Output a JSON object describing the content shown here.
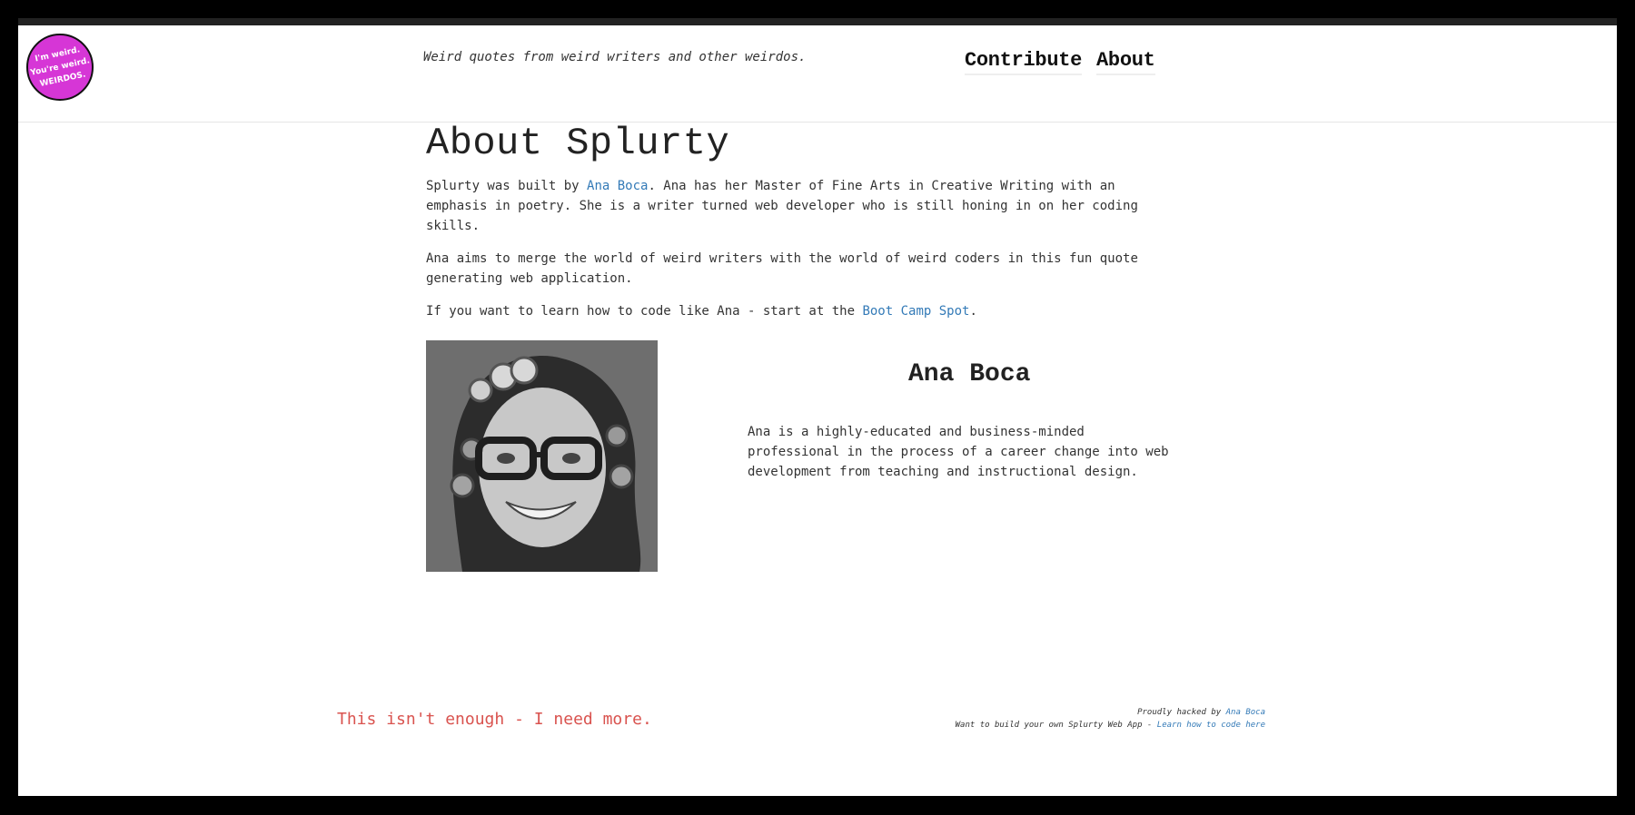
{
  "header": {
    "logo_text": "I'm weird.\nYou're weird.\nWEIRDOS.",
    "tagline": "Weird quotes from weird writers and other weirdos.",
    "nav": {
      "contribute": "Contribute",
      "about": "About"
    }
  },
  "main": {
    "title": "About Splurty",
    "para1": {
      "before": "Splurty was built by ",
      "link": "Ana Boca",
      "after": ". Ana has her Master of Fine Arts in Creative Writing with an emphasis in poetry. She is a writer turned web developer who is still honing in on her coding skills."
    },
    "para2": "Ana aims to merge the world of weird writers with the world of weird coders in this fun quote generating web application.",
    "para3": {
      "before": "If you want to learn how to code like Ana - start at the ",
      "link": "Boot Camp Spot",
      "after": "."
    }
  },
  "profile": {
    "name": "Ana Boca",
    "bio": "Ana is a highly-educated and business-minded professional in the process of a career change into web development from teaching and instructional design."
  },
  "more_link": "This isn't enough - I need more.",
  "footer": {
    "line1_before": "Proudly hacked by ",
    "line1_link": "Ana Boca",
    "line2_before": "Want to build your own Splurty Web App - ",
    "line2_link": "Learn how to code here"
  },
  "colors": {
    "logo": "#d636d6",
    "link": "#337ab7",
    "more_link": "#d9534f"
  }
}
